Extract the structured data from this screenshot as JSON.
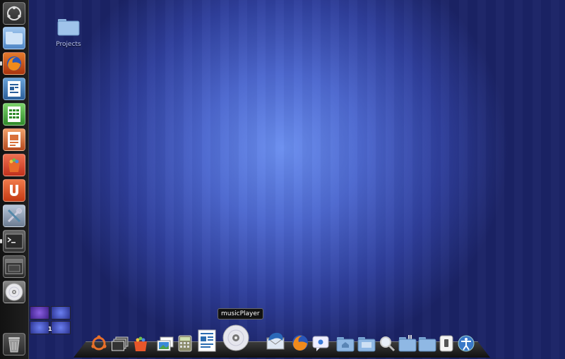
{
  "desktop": {
    "folder_label": "Projects"
  },
  "launcher": {
    "items": [
      {
        "name": "dash-home",
        "icon": "ubuntu-logo-icon"
      },
      {
        "name": "files",
        "icon": "folder-icon"
      },
      {
        "name": "firefox",
        "icon": "firefox-icon"
      },
      {
        "name": "writer",
        "icon": "libreoffice-writer-icon"
      },
      {
        "name": "calc",
        "icon": "libreoffice-calc-icon"
      },
      {
        "name": "impress",
        "icon": "libreoffice-impress-icon"
      },
      {
        "name": "software-center",
        "icon": "shopping-bag-icon"
      },
      {
        "name": "ubuntu-one",
        "icon": "ubuntu-one-icon"
      },
      {
        "name": "system-settings",
        "icon": "tools-icon"
      },
      {
        "name": "terminal",
        "icon": "terminal-icon"
      },
      {
        "name": "window-app",
        "icon": "window-icon"
      },
      {
        "name": "music-player",
        "icon": "cd-icon"
      },
      {
        "name": "trash",
        "icon": "trash-icon"
      }
    ]
  },
  "workspaces": {
    "active_index": "1"
  },
  "dock": {
    "tooltip": "musicPlayer",
    "items": [
      "ubuntu-logo-icon",
      "windows-stack-icon",
      "software-bag-icon",
      "image-viewer-icon",
      "calculator-icon",
      "writer-document-icon",
      "cd-icon",
      "thunderbird-icon",
      "firefox-icon",
      "chat-icon",
      "home-folder-icon",
      "folder-icon",
      "search-icon",
      "music-folder-icon",
      "folder-icon",
      "switch-icon",
      "accessibility-icon"
    ]
  },
  "colors": {
    "wallpaper_center": "#6b8ff0",
    "wallpaper_edge": "#1b2366",
    "launcher_bg": "#1a1a1a"
  }
}
